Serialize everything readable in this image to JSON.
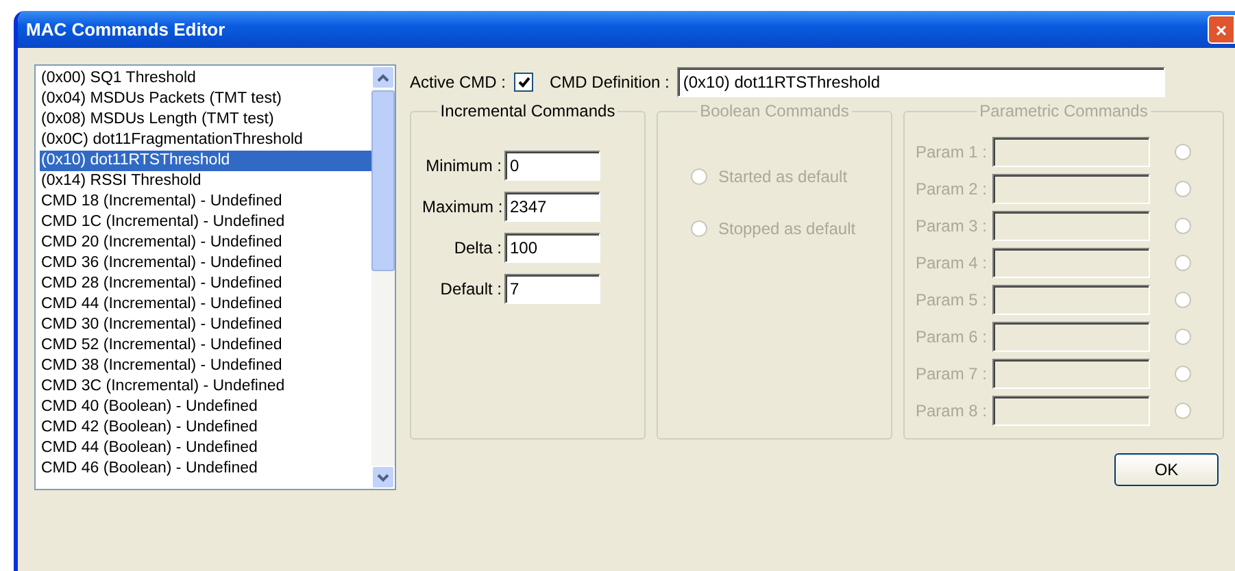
{
  "window": {
    "title": "MAC Commands Editor",
    "close": "×"
  },
  "commands": [
    {
      "label": "(0x00) SQ1 Threshold",
      "selected": false
    },
    {
      "label": "(0x04) MSDUs Packets (TMT test)",
      "selected": false
    },
    {
      "label": "(0x08) MSDUs Length (TMT test)",
      "selected": false
    },
    {
      "label": "(0x0C) dot11FragmentationThreshold",
      "selected": false
    },
    {
      "label": "(0x10) dot11RTSThreshold",
      "selected": true
    },
    {
      "label": "(0x14) RSSI Threshold",
      "selected": false
    },
    {
      "label": "CMD 18 (Incremental) - Undefined",
      "selected": false
    },
    {
      "label": "CMD 1C (Incremental) - Undefined",
      "selected": false
    },
    {
      "label": "CMD 20 (Incremental) - Undefined",
      "selected": false
    },
    {
      "label": "CMD 36 (Incremental) - Undefined",
      "selected": false
    },
    {
      "label": "CMD 28 (Incremental) - Undefined",
      "selected": false
    },
    {
      "label": "CMD 44 (Incremental) - Undefined",
      "selected": false
    },
    {
      "label": "CMD 30 (Incremental) - Undefined",
      "selected": false
    },
    {
      "label": "CMD 52 (Incremental) - Undefined",
      "selected": false
    },
    {
      "label": "CMD 38 (Incremental) - Undefined",
      "selected": false
    },
    {
      "label": "CMD 3C (Incremental) - Undefined",
      "selected": false
    },
    {
      "label": "CMD 40 (Boolean) - Undefined",
      "selected": false
    },
    {
      "label": "CMD 42 (Boolean) - Undefined",
      "selected": false
    },
    {
      "label": "CMD 44 (Boolean) - Undefined",
      "selected": false
    },
    {
      "label": "CMD 46 (Boolean) - Undefined",
      "selected": false
    }
  ],
  "active_cmd": {
    "label": "Active CMD :",
    "checked": true
  },
  "cmd_definition": {
    "label": "CMD Definition :",
    "value": "(0x10) dot11RTSThreshold"
  },
  "incremental": {
    "title": "Incremental Commands",
    "disabled": false,
    "fields": [
      {
        "label": "Minimum :",
        "value": "0"
      },
      {
        "label": "Maximum :",
        "value": "2347"
      },
      {
        "label": "Delta :",
        "value": "100"
      },
      {
        "label": "Default :",
        "value": "7"
      }
    ]
  },
  "boolean": {
    "title": "Boolean Commands",
    "disabled": true,
    "options": [
      {
        "label": "Started as default",
        "selected": false
      },
      {
        "label": "Stopped as default",
        "selected": false
      }
    ]
  },
  "parametric": {
    "title": "Parametric Commands",
    "disabled": true,
    "params": [
      {
        "label": "Param 1 :",
        "selected": false
      },
      {
        "label": "Param 2 :",
        "selected": false
      },
      {
        "label": "Param 3 :",
        "selected": false
      },
      {
        "label": "Param 4 :",
        "selected": false
      },
      {
        "label": "Param 5 :",
        "selected": false
      },
      {
        "label": "Param 6 :",
        "selected": false
      },
      {
        "label": "Param 7 :",
        "selected": false
      },
      {
        "label": "Param 8 :",
        "selected": false
      }
    ]
  },
  "ok_button": "OK"
}
